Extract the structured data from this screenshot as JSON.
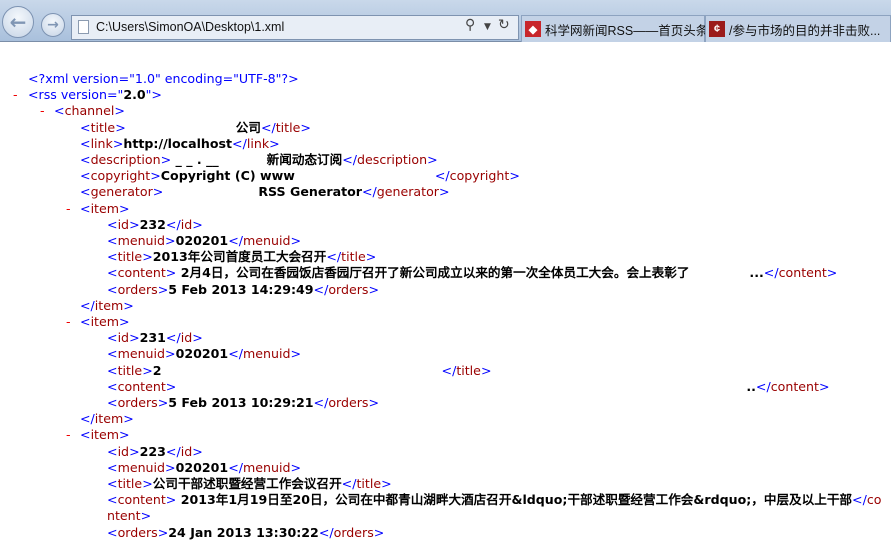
{
  "browser": {
    "address": "C:\\Users\\SimonOA\\Desktop\\1.xml",
    "tabs": [
      {
        "label": "科学网新闻RSS——首页头条",
        "icon": "rss-red-icon",
        "color": "#c8262b"
      },
      {
        "label": "/参与市场的目的并非击败...",
        "icon": "cent-icon",
        "color": "#9b1b1b"
      }
    ]
  },
  "xml": {
    "declaration": "<?xml version=\"1.0\" encoding=\"UTF-8\"?>",
    "rss_open_prefix": "<rss version=\"",
    "rss_version": "2.0",
    "rss_open_suffix": "\">",
    "lines": [
      {
        "type": "open",
        "name": "channel",
        "depth": 1
      },
      {
        "type": "leaf",
        "name": "title",
        "depth": 2,
        "segments": [
          "",
          "公司"
        ]
      },
      {
        "type": "leaf",
        "name": "link",
        "depth": 2,
        "segments": [
          "http://localhost"
        ]
      },
      {
        "type": "leaf",
        "name": "description",
        "depth": 2,
        "segments": [
          " _ _ . __",
          "新闻动态订阅"
        ]
      },
      {
        "type": "leaf",
        "name": "copyright",
        "depth": 2,
        "segments": [
          "Copyright (C) www",
          ""
        ]
      },
      {
        "type": "leaf",
        "name": "generator",
        "depth": 2,
        "segments": [
          "",
          "RSS Generator"
        ]
      },
      {
        "type": "open",
        "name": "item",
        "depth": 2
      },
      {
        "type": "leaf",
        "name": "id",
        "depth": 3,
        "segments": [
          "232"
        ]
      },
      {
        "type": "leaf",
        "name": "menuid",
        "depth": 3,
        "segments": [
          "020201"
        ]
      },
      {
        "type": "leaf",
        "name": "title",
        "depth": 3,
        "segments": [
          "2013年公司首度员工大会召开"
        ]
      },
      {
        "type": "leaf",
        "name": "content",
        "depth": 3,
        "segments": [
          " 2月4日，公司在香园饭店香园厅召开了新公司成立以来的第一次全体员工大会。会上表彰了",
          "..."
        ],
        "cut": true
      },
      {
        "type": "leaf",
        "name": "orders",
        "depth": 3,
        "segments": [
          "5 Feb 2013 14:29:49"
        ]
      },
      {
        "type": "close",
        "name": "item",
        "depth": 2
      },
      {
        "type": "open",
        "name": "item",
        "depth": 2
      },
      {
        "type": "leaf",
        "name": "id",
        "depth": 3,
        "segments": [
          "231"
        ]
      },
      {
        "type": "leaf",
        "name": "menuid",
        "depth": 3,
        "segments": [
          "020201"
        ]
      },
      {
        "type": "leaf",
        "name": "title",
        "depth": 3,
        "segments": [
          "2",
          ""
        ]
      },
      {
        "type": "leaf",
        "name": "content",
        "depth": 3,
        "segments": [
          "",
          "",
          ".."
        ],
        "cut": true
      },
      {
        "type": "leaf",
        "name": "orders",
        "depth": 3,
        "segments": [
          "5 Feb 2013 10:29:21"
        ]
      },
      {
        "type": "close",
        "name": "item",
        "depth": 2
      },
      {
        "type": "open",
        "name": "item",
        "depth": 2
      },
      {
        "type": "leaf",
        "name": "id",
        "depth": 3,
        "segments": [
          "223"
        ]
      },
      {
        "type": "leaf",
        "name": "menuid",
        "depth": 3,
        "segments": [
          "020201"
        ]
      },
      {
        "type": "leaf",
        "name": "title",
        "depth": 3,
        "segments": [
          "公司干部述职暨经营工作会议召开"
        ]
      },
      {
        "type": "leaf",
        "name": "content",
        "depth": 3,
        "segments": [
          " 2013年1月19日至20日，公司在中都青山湖畔大酒店召开&ldquo;干部述职暨经营工作会&rdquo;，中层及以上干部"
        ],
        "cut": true
      },
      {
        "type": "leaf",
        "name": "orders",
        "depth": 3,
        "segments": [
          "24 Jan 2013 13:30:22"
        ]
      }
    ]
  }
}
